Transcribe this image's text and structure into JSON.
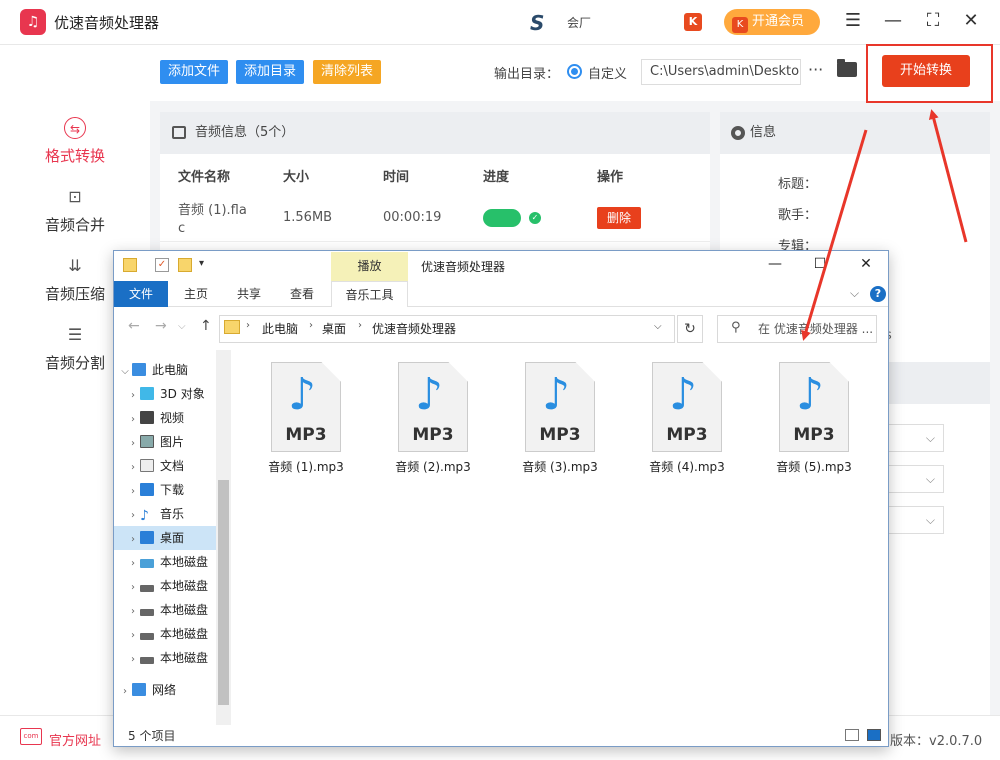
{
  "app": {
    "title": "优速音频处理器",
    "brand_text": "会厂",
    "vip_label": "开通会员",
    "window_controls": [
      "☰",
      "—",
      "⛶",
      "✕"
    ]
  },
  "sidebar": {
    "items": [
      {
        "label": "格式转换",
        "icon": "convert-icon",
        "active": true
      },
      {
        "label": "音频合并",
        "icon": "merge-icon",
        "active": false
      },
      {
        "label": "音频压缩",
        "icon": "compress-icon",
        "active": false
      },
      {
        "label": "音频分割",
        "icon": "split-icon",
        "active": false
      }
    ]
  },
  "toolbar": {
    "add_file": "添加文件",
    "add_dir": "添加目录",
    "clear_list": "清除列表",
    "output_label": "输出目录：",
    "custom_label": "自定义",
    "output_path": "C:\\Users\\admin\\Deskto",
    "more": "···",
    "start": "开始转换"
  },
  "audio_panel": {
    "header": "音频信息（5个）",
    "columns": [
      "文件名称",
      "大小",
      "时间",
      "进度",
      "操作"
    ],
    "rows": [
      {
        "name_line1": "音频 (1).fla",
        "name_line2": "c",
        "size": "1.56MB",
        "time": "00:00:19",
        "progress": 1.0,
        "action": "删除"
      }
    ]
  },
  "info_panel": {
    "header": "信息",
    "fields": [
      "标题：",
      "歌手：",
      "专辑："
    ],
    "trailing_text": "s"
  },
  "footer": {
    "website": "官方网址",
    "website_icon_text": "com",
    "version": "版本：v2.0.7.0"
  },
  "explorer": {
    "title": "优速音频处理器",
    "context_tab": "播放",
    "ribbon_tabs": [
      "文件",
      "主页",
      "共享",
      "查看",
      "音乐工具"
    ],
    "breadcrumb": [
      "此电脑",
      "桌面",
      "优速音频处理器"
    ],
    "search_placeholder": "在 优速音频处理器 ...",
    "tree": [
      {
        "label": "此电脑",
        "expanded": true,
        "icon": "pc-icon"
      },
      {
        "label": "3D 对象",
        "icon": "3d-icon"
      },
      {
        "label": "视频",
        "icon": "video-icon"
      },
      {
        "label": "图片",
        "icon": "picture-icon"
      },
      {
        "label": "文档",
        "icon": "document-icon"
      },
      {
        "label": "下载",
        "icon": "download-icon"
      },
      {
        "label": "音乐",
        "icon": "music-icon"
      },
      {
        "label": "桌面",
        "icon": "desktop-icon",
        "selected": true
      },
      {
        "label": "本地磁盘",
        "icon": "disk-icon"
      },
      {
        "label": "本地磁盘",
        "icon": "disk-icon"
      },
      {
        "label": "本地磁盘",
        "icon": "disk-icon"
      },
      {
        "label": "本地磁盘",
        "icon": "disk-icon"
      },
      {
        "label": "本地磁盘",
        "icon": "disk-icon"
      },
      {
        "label": "网络",
        "icon": "network-icon"
      }
    ],
    "files": [
      {
        "name": "音频 (1).mp3",
        "badge": "MP3"
      },
      {
        "name": "音频 (2).mp3",
        "badge": "MP3"
      },
      {
        "name": "音频 (3).mp3",
        "badge": "MP3"
      },
      {
        "name": "音频 (4).mp3",
        "badge": "MP3"
      },
      {
        "name": "音频 (5).mp3",
        "badge": "MP3"
      }
    ],
    "status": "5 个项目"
  },
  "colors": {
    "accent_red": "#e8364f",
    "start_button": "#e8401c",
    "blue_button": "#2f8ef0",
    "orange_button": "#f5a623",
    "annotation_red": "#e8362a"
  }
}
